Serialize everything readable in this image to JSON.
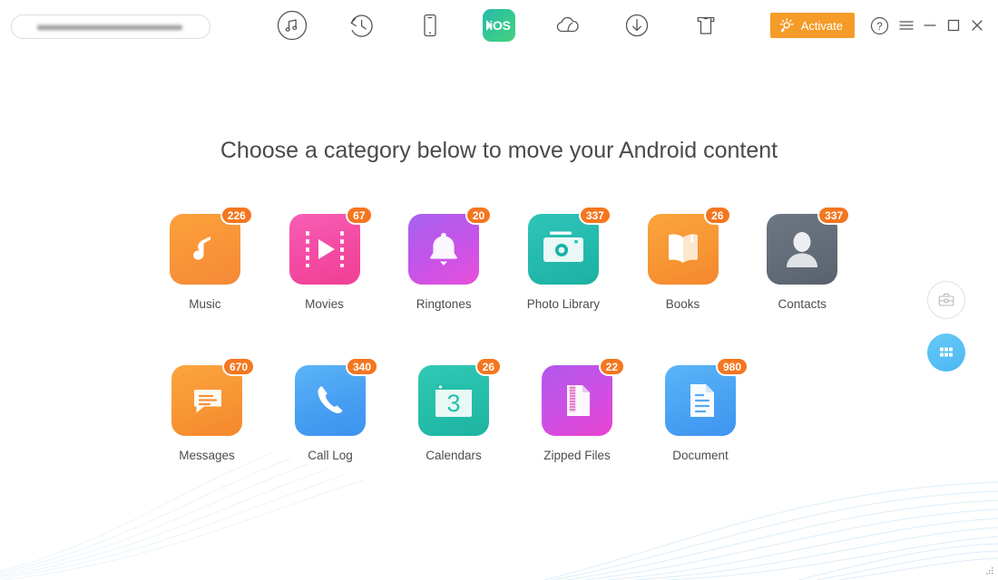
{
  "window": {
    "search": {
      "value": "",
      "placeholder": "",
      "redacted": true
    },
    "activate_label": "Activate",
    "controls": {
      "help": "?",
      "menu": "menu-icon",
      "minimize": "minimize-icon",
      "maximize": "maximize-icon",
      "close": "close-icon"
    }
  },
  "toolbar": {
    "items": [
      {
        "icon": "music-note-circle-icon",
        "name": "music-manager"
      },
      {
        "icon": "history-clock-circle-icon",
        "name": "backup-restore"
      },
      {
        "icon": "phone-device-icon",
        "name": "device-manager"
      },
      {
        "icon": "ios-transfer-icon",
        "name": "move-to-ios",
        "label": "iOS",
        "active": true
      },
      {
        "icon": "cloud-icon",
        "name": "cloud-manager"
      },
      {
        "icon": "download-arrow-circle-icon",
        "name": "downloader"
      },
      {
        "icon": "tshirt-icon",
        "name": "ringtone-maker"
      }
    ]
  },
  "main": {
    "headline": "Choose a category below to move your Android content",
    "categories": [
      {
        "label": "Music",
        "count": "226",
        "icon": "music-note-icon",
        "theme": "g-music"
      },
      {
        "label": "Movies",
        "count": "67",
        "icon": "film-play-icon",
        "theme": "g-movies"
      },
      {
        "label": "Ringtones",
        "count": "20",
        "icon": "bell-icon",
        "theme": "g-ring"
      },
      {
        "label": "Photo Library",
        "count": "337",
        "icon": "camera-icon",
        "theme": "g-photo"
      },
      {
        "label": "Books",
        "count": "26",
        "icon": "open-book-icon",
        "theme": "g-books"
      },
      {
        "label": "Contacts",
        "count": "337",
        "icon": "person-icon",
        "theme": "g-contacts"
      },
      {
        "label": "Messages",
        "count": "670",
        "icon": "chat-bubble-icon",
        "theme": "g-msg"
      },
      {
        "label": "Call Log",
        "count": "340",
        "icon": "phone-handset-icon",
        "theme": "g-call"
      },
      {
        "label": "Calendars",
        "count": "26",
        "icon": "calendar-icon",
        "theme": "g-cal",
        "day": "3"
      },
      {
        "label": "Zipped Files",
        "count": "22",
        "icon": "zip-file-icon",
        "theme": "g-zip"
      },
      {
        "label": "Document",
        "count": "980",
        "icon": "document-icon",
        "theme": "g-doc"
      }
    ]
  },
  "float_buttons": [
    {
      "name": "toolbox-button",
      "icon": "briefcase-icon",
      "style": "outline"
    },
    {
      "name": "apps-grid-button",
      "icon": "grid-apps-icon",
      "style": "filled"
    }
  ],
  "colors": {
    "accent_orange": "#f49b28",
    "badge_orange": "#f4761f",
    "ios_green": "#35c98f",
    "float_blue": "#4cb9f2",
    "text_dark": "#4a4a4a"
  }
}
